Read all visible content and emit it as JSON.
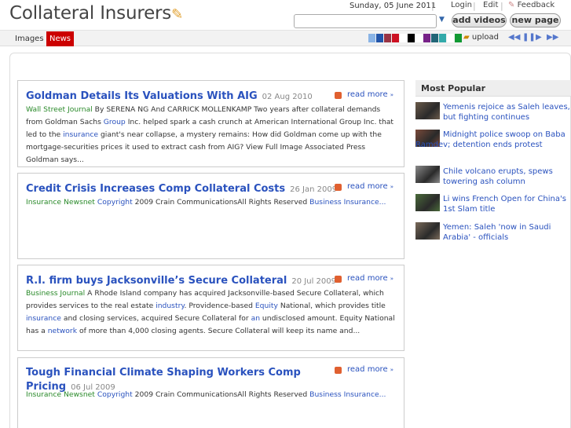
{
  "header": {
    "logo": "Collateral Insurers",
    "date": "Sunday, 05 June 2011",
    "login": "Login",
    "edit": "Edit",
    "feedback": "Feedback",
    "add_videos": "add videos",
    "new_page": "new page",
    "search_value": ""
  },
  "nav": {
    "tabs": [
      "Images",
      "News"
    ],
    "upload": "upload",
    "swatches": [
      "#8ab4e6",
      "#2255aa",
      "#993344",
      "#cc1122",
      "#ffffff",
      "#000000",
      "#ffffff",
      "#772288",
      "#226677",
      "#33aaaa",
      "#119933",
      "#ffffff"
    ]
  },
  "articles": [
    {
      "title": "Goldman Details Its Valuations With AIG",
      "date": "02 Aug 2010",
      "source": "Wall Street Journal",
      "read_more": "read more",
      "body": [
        {
          "t": "  By SERENA NG And CARRICK MOLLENKAMP Two years after collateral demands from Goldman Sachs "
        },
        {
          "t": "Group",
          "link": true
        },
        {
          "t": " Inc. helped spark a cash crunch at American International Group Inc. that led to the "
        },
        {
          "t": "insurance",
          "link": true
        },
        {
          "t": " giant's near collapse, a mystery remains: How did Goldman come up with the mortgage-securities prices it used to extract cash from AIG? View Full Image Associated Press Goldman says..."
        }
      ]
    },
    {
      "title": "Credit Crisis Increases Comp Collateral Costs",
      "date": "26 Jan 2009",
      "source": "Insurance Newsnet",
      "read_more": "read more",
      "body": [
        {
          "t": "  "
        },
        {
          "t": "Copyright",
          "link": true
        },
        {
          "t": " 2009 Crain CommunicationsAll Rights Reserved "
        },
        {
          "t": "Business Insurance...",
          "link": true
        }
      ]
    },
    {
      "title": "R.I. firm buys Jacksonville’s Secure Collateral",
      "date": "20 Jul 2009",
      "source": "Business Journal",
      "read_more": "read more",
      "body": [
        {
          "t": "  A Rhode Island company has acquired Jacksonville-based Secure Collateral, which provides services to the real estate "
        },
        {
          "t": "industry",
          "link": true
        },
        {
          "t": ". Providence-based "
        },
        {
          "t": "Equity",
          "link": true
        },
        {
          "t": " National, which provides title "
        },
        {
          "t": "insurance",
          "link": true
        },
        {
          "t": " and closing services, acquired Secure Collateral for "
        },
        {
          "t": "an",
          "link": true
        },
        {
          "t": " undisclosed amount. Equity National has a "
        },
        {
          "t": "network",
          "link": true
        },
        {
          "t": " of more than 4,000 closing agents. Secure Collateral will keep its name and..."
        }
      ]
    },
    {
      "title": "Tough Financial Climate Shaping Workers Comp Pricing",
      "date": "06 Jul 2009",
      "source": "Insurance Newsnet",
      "read_more": "read more",
      "body": [
        {
          "t": "  "
        },
        {
          "t": "Copyright",
          "link": true
        },
        {
          "t": " 2009 Crain CommunicationsAll Rights Reserved "
        },
        {
          "t": "Business Insurance...",
          "link": true
        }
      ]
    }
  ],
  "sidebar": {
    "title": "Most Popular",
    "items": [
      {
        "text": "Yemenis rejoice as Saleh leaves, but fighting continues",
        "thumb": "#6a5a4a"
      },
      {
        "text": "Midnight police swoop on Baba Ramdev; detention ends protest",
        "thumb": "#7a4a3a"
      },
      {
        "text": "Chile volcano erupts, spews towering ash column",
        "thumb": "#8a8a8a"
      },
      {
        "text": "Li wins French Open for China's 1st Slam title",
        "thumb": "#4a6a3a"
      },
      {
        "text": "Yemen: Saleh 'now in Saudi Arabia' - officials",
        "thumb": "#7a6a5a"
      }
    ]
  }
}
